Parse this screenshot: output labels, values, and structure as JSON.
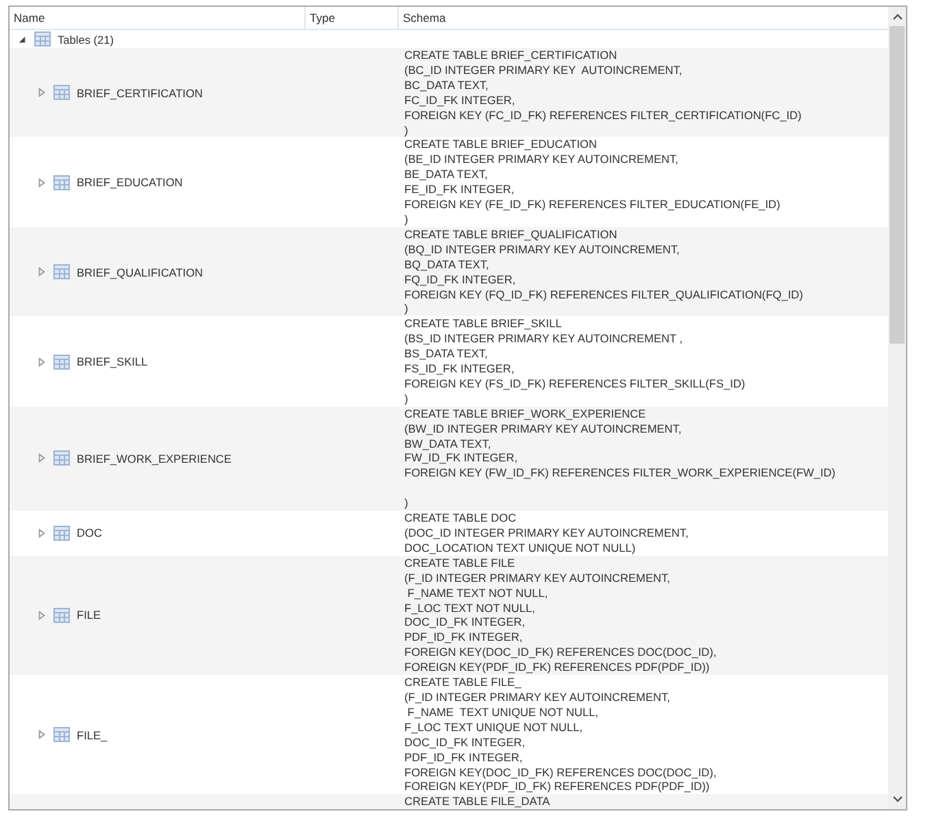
{
  "columns": [
    "Name",
    "Type",
    "Schema"
  ],
  "tree": {
    "label": "Tables (21)",
    "expanded": true,
    "children": [
      {
        "name": "BRIEF_CERTIFICATION",
        "expanded": false,
        "schema": "CREATE TABLE BRIEF_CERTIFICATION\n(BC_ID INTEGER PRIMARY KEY  AUTOINCREMENT,\nBC_DATA TEXT,\nFC_ID_FK INTEGER,\nFOREIGN KEY (FC_ID_FK) REFERENCES FILTER_CERTIFICATION(FC_ID)\n)"
      },
      {
        "name": "BRIEF_EDUCATION",
        "expanded": false,
        "schema": "CREATE TABLE BRIEF_EDUCATION\n(BE_ID INTEGER PRIMARY KEY AUTOINCREMENT,\nBE_DATA TEXT,\nFE_ID_FK INTEGER,\nFOREIGN KEY (FE_ID_FK) REFERENCES FILTER_EDUCATION(FE_ID)\n)"
      },
      {
        "name": "BRIEF_QUALIFICATION",
        "expanded": false,
        "schema": "CREATE TABLE BRIEF_QUALIFICATION\n(BQ_ID INTEGER PRIMARY KEY AUTOINCREMENT,\nBQ_DATA TEXT,\nFQ_ID_FK INTEGER,\nFOREIGN KEY (FQ_ID_FK) REFERENCES FILTER_QUALIFICATION(FQ_ID)\n)"
      },
      {
        "name": "BRIEF_SKILL",
        "expanded": false,
        "schema": "CREATE TABLE BRIEF_SKILL\n(BS_ID INTEGER PRIMARY KEY AUTOINCREMENT ,\nBS_DATA TEXT,\nFS_ID_FK INTEGER,\nFOREIGN KEY (FS_ID_FK) REFERENCES FILTER_SKILL(FS_ID)\n)"
      },
      {
        "name": "BRIEF_WORK_EXPERIENCE",
        "expanded": false,
        "schema": "CREATE TABLE BRIEF_WORK_EXPERIENCE\n(BW_ID INTEGER PRIMARY KEY AUTOINCREMENT,\nBW_DATA TEXT,\nFW_ID_FK INTEGER,\nFOREIGN KEY (FW_ID_FK) REFERENCES FILTER_WORK_EXPERIENCE(FW_ID)\n\n)"
      },
      {
        "name": "DOC",
        "expanded": false,
        "schema": "CREATE TABLE DOC\n(DOC_ID INTEGER PRIMARY KEY AUTOINCREMENT,\nDOC_LOCATION TEXT UNIQUE NOT NULL)"
      },
      {
        "name": "FILE",
        "expanded": false,
        "schema": "CREATE TABLE FILE\n(F_ID INTEGER PRIMARY KEY AUTOINCREMENT,\n F_NAME TEXT NOT NULL,\nF_LOC TEXT NOT NULL,\nDOC_ID_FK INTEGER,\nPDF_ID_FK INTEGER,\nFOREIGN KEY(DOC_ID_FK) REFERENCES DOC(DOC_ID),\nFOREIGN KEY(PDF_ID_FK) REFERENCES PDF(PDF_ID))"
      },
      {
        "name": "FILE_",
        "expanded": false,
        "schema": "CREATE TABLE FILE_\n(F_ID INTEGER PRIMARY KEY AUTOINCREMENT,\n F_NAME  TEXT UNIQUE NOT NULL,\nF_LOC TEXT UNIQUE NOT NULL,\nDOC_ID_FK INTEGER,\nPDF_ID_FK INTEGER,\nFOREIGN KEY(DOC_ID_FK) REFERENCES DOC(DOC_ID),\nFOREIGN KEY(PDF_ID_FK) REFERENCES PDF(PDF_ID))"
      },
      {
        "schema": "CREATE TABLE FILE_DATA"
      }
    ]
  }
}
